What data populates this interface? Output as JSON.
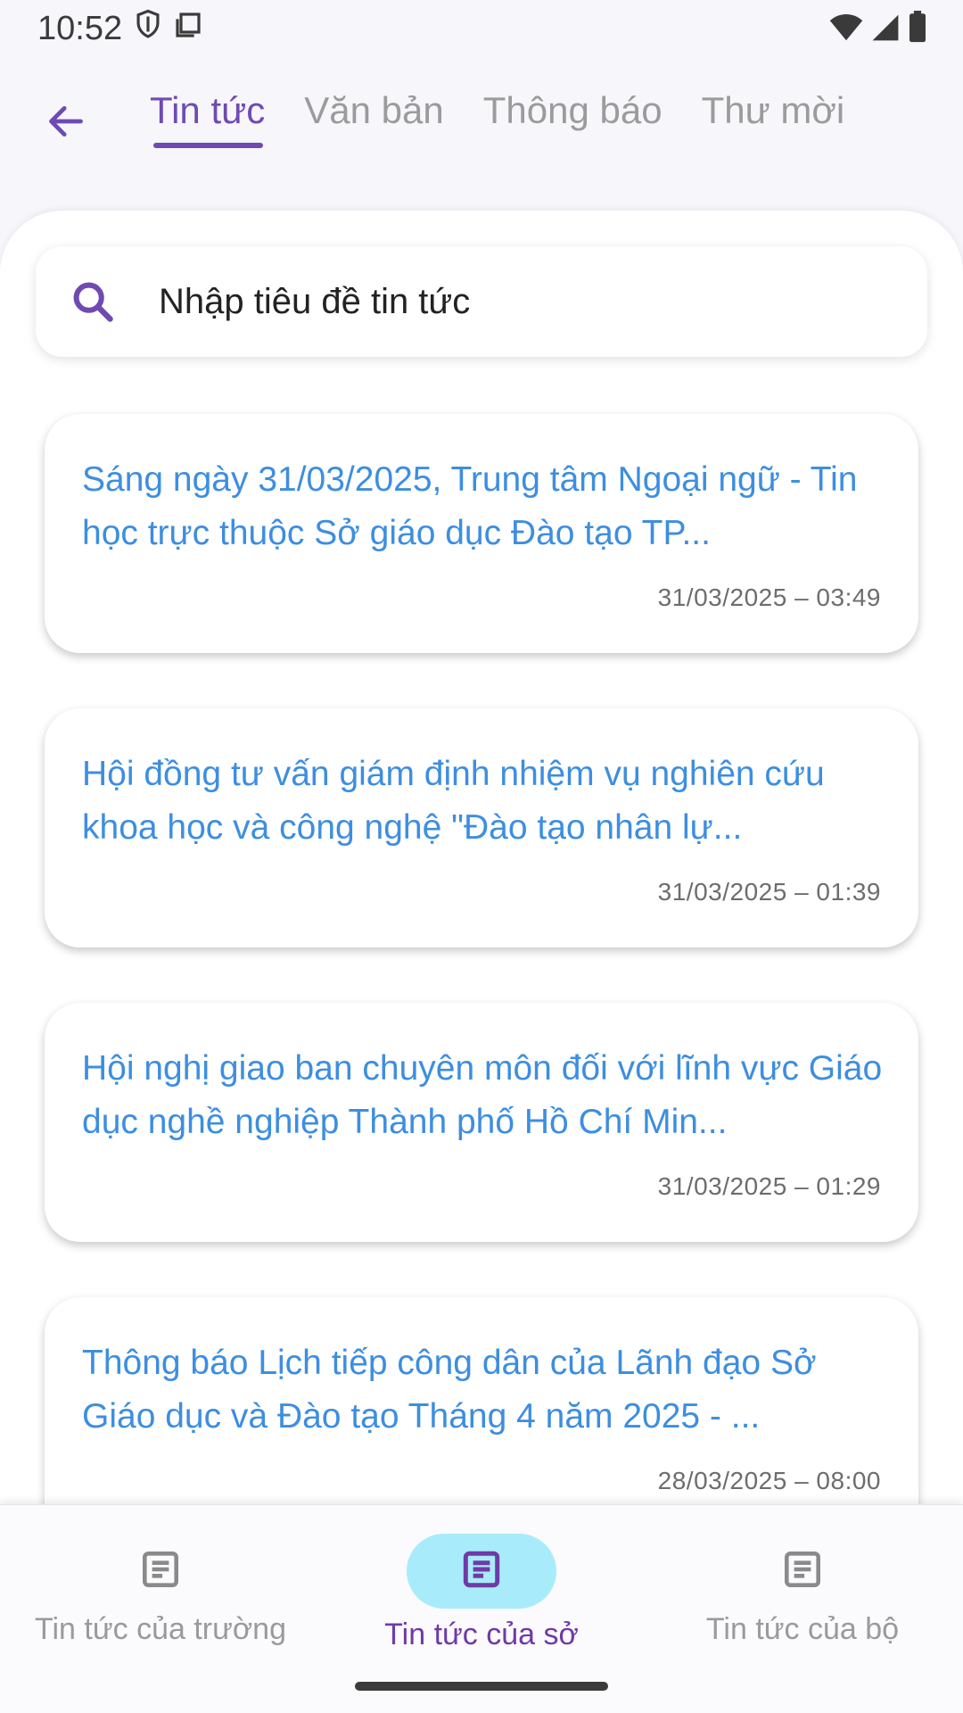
{
  "status_bar": {
    "time": "10:52",
    "icons": [
      "shield-icon",
      "screenshot-icon",
      "wifi-icon",
      "signal-icon",
      "battery-icon"
    ]
  },
  "top_tabs": [
    {
      "label": "Tin tức",
      "active": true
    },
    {
      "label": "Văn bản",
      "active": false
    },
    {
      "label": "Thông báo",
      "active": false
    },
    {
      "label": "Thư mời",
      "active": false
    }
  ],
  "search": {
    "placeholder": "Nhập tiêu đề tin tức"
  },
  "news": [
    {
      "title": "Sáng ngày 31/03/2025, Trung tâm Ngoại ngữ - Tin học trực thuộc Sở giáo dục Đào tạo TP...",
      "date": "31/03/2025 – 03:49"
    },
    {
      "title": "Hội đồng tư vấn giám định nhiệm vụ nghiên cứu khoa học và công nghệ \"Đào tạo nhân lự...",
      "date": "31/03/2025 – 01:39"
    },
    {
      "title": "Hội nghị giao ban chuyên môn đối với lĩnh vực Giáo dục nghề nghiệp Thành phố Hồ Chí Min...",
      "date": "31/03/2025 – 01:29"
    },
    {
      "title": "Thông báo Lịch tiếp công dân của Lãnh đạo Sở Giáo dục và Đào tạo Tháng 4 năm 2025 - ...",
      "date": "28/03/2025 – 08:00"
    }
  ],
  "bottom_nav": [
    {
      "label": "Tin tức của trường",
      "active": false
    },
    {
      "label": "Tin tức của sở",
      "active": true
    },
    {
      "label": "Tin tức của bộ",
      "active": false
    }
  ],
  "colors": {
    "accent": "#6f4bb1",
    "link_blue": "#3d8ee0",
    "active_pill": "#a8ecfb"
  }
}
